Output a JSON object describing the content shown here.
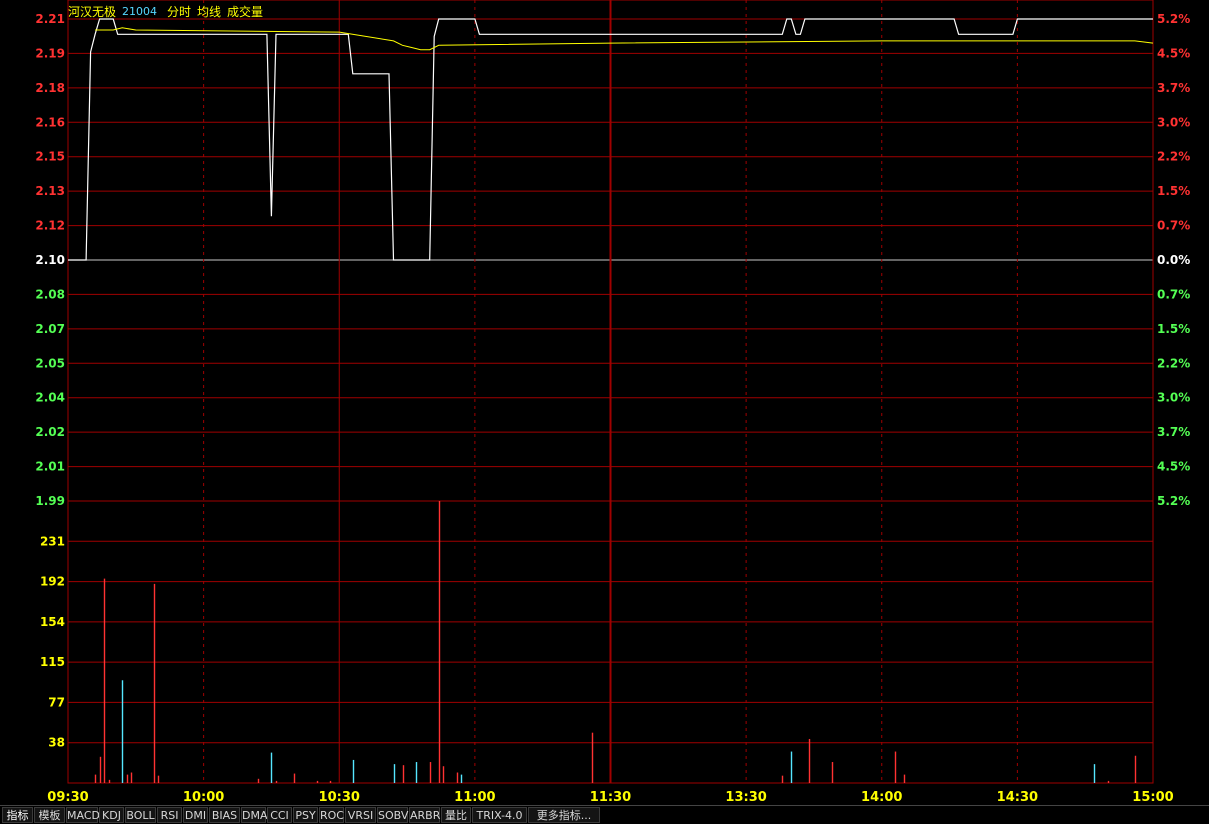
{
  "header": {
    "stock_name": "河汉无极",
    "stock_code": "21004",
    "label_time": "分时",
    "label_avg": "均线",
    "label_volume": "成交量"
  },
  "tabs": [
    "指标",
    "模板",
    "MACD",
    "KDJ",
    "BOLL",
    "RSI",
    "DMI",
    "BIAS",
    "DMA",
    "CCI",
    "PSY",
    "ROC",
    "VRSI",
    "SOBV",
    "ARBR",
    "量比",
    "TRIX-4.0",
    "更多指标..."
  ],
  "colors": {
    "background": "#000000",
    "grid": "#a00000",
    "price_line": "#ffffff",
    "avg_line": "#ffff00",
    "up": "#ff3232",
    "down": "#54ff54",
    "flat": "#ffffff",
    "vol_up": "#ff3232",
    "vol_down": "#55e6ff",
    "time_label": "#ffff00"
  },
  "chart_data": [
    {
      "type": "line",
      "prev_close": 2.1,
      "ylim": [
        1.99,
        2.21
      ],
      "y_ticks_left": [
        "2.21",
        "2.19",
        "2.18",
        "2.16",
        "2.15",
        "2.13",
        "2.12",
        "2.10",
        "2.08",
        "2.07",
        "2.05",
        "2.04",
        "2.02",
        "2.01",
        "1.99"
      ],
      "y_ticks_right": [
        "5.2%",
        "4.5%",
        "3.7%",
        "3.0%",
        "2.2%",
        "1.5%",
        "0.7%",
        "0.0%",
        "0.7%",
        "1.5%",
        "2.2%",
        "3.0%",
        "3.7%",
        "4.5%",
        "5.2%"
      ],
      "x_ticks": [
        "09:30",
        "10:00",
        "10:30",
        "11:00",
        "11:30",
        "13:30",
        "14:00",
        "14:30",
        "15:00"
      ],
      "series": [
        {
          "role": "price",
          "x": [
            "09:30",
            "09:34",
            "09:35",
            "09:36",
            "09:37",
            "09:40",
            "09:41",
            "09:42",
            "10:14",
            "10:15",
            "10:16",
            "10:17",
            "10:32",
            "10:33",
            "10:41",
            "10:42",
            "10:50",
            "10:51",
            "10:52",
            "11:00",
            "11:01",
            "13:38",
            "13:39",
            "13:40",
            "13:41",
            "13:42",
            "13:43",
            "14:16",
            "14:17",
            "14:29",
            "14:30",
            "15:00"
          ],
          "values": [
            2.1,
            2.1,
            2.195,
            2.203,
            2.21,
            2.21,
            2.203,
            2.203,
            2.203,
            2.12,
            2.203,
            2.203,
            2.203,
            2.185,
            2.185,
            2.1,
            2.1,
            2.202,
            2.21,
            2.21,
            2.203,
            2.203,
            2.21,
            2.21,
            2.203,
            2.203,
            2.21,
            2.21,
            2.203,
            2.203,
            2.21,
            2.21
          ]
        },
        {
          "role": "avg",
          "x": [
            "09:36",
            "09:40",
            "09:42",
            "09:45",
            "10:30",
            "10:42",
            "10:44",
            "10:46",
            "10:48",
            "10:50",
            "10:52",
            "11:30",
            "14:00",
            "14:56",
            "15:00"
          ],
          "values": [
            2.205,
            2.205,
            2.206,
            2.205,
            2.204,
            2.2,
            2.198,
            2.197,
            2.196,
            2.196,
            2.198,
            2.199,
            2.2,
            2.2,
            2.199
          ]
        }
      ]
    },
    {
      "type": "bar",
      "ylim": [
        0,
        269
      ],
      "y_ticks": [
        "231",
        "192",
        "154",
        "115",
        "77",
        "38"
      ],
      "bars": [
        {
          "t": "09:36",
          "v": 8,
          "dir": "up"
        },
        {
          "t": "09:37",
          "v": 25,
          "dir": "up"
        },
        {
          "t": "09:38",
          "v": 195,
          "dir": "up"
        },
        {
          "t": "09:39",
          "v": 3,
          "dir": "up"
        },
        {
          "t": "09:42",
          "v": 98,
          "dir": "down"
        },
        {
          "t": "09:43",
          "v": 8,
          "dir": "up"
        },
        {
          "t": "09:44",
          "v": 10,
          "dir": "up"
        },
        {
          "t": "09:49",
          "v": 190,
          "dir": "up"
        },
        {
          "t": "09:50",
          "v": 7,
          "dir": "up"
        },
        {
          "t": "10:12",
          "v": 4,
          "dir": "up"
        },
        {
          "t": "10:15",
          "v": 29,
          "dir": "down"
        },
        {
          "t": "10:16",
          "v": 2,
          "dir": "up"
        },
        {
          "t": "10:20",
          "v": 9,
          "dir": "up"
        },
        {
          "t": "10:25",
          "v": 2,
          "dir": "up"
        },
        {
          "t": "10:28",
          "v": 2,
          "dir": "up"
        },
        {
          "t": "10:33",
          "v": 22,
          "dir": "down"
        },
        {
          "t": "10:42",
          "v": 18,
          "dir": "down"
        },
        {
          "t": "10:44",
          "v": 17,
          "dir": "up"
        },
        {
          "t": "10:47",
          "v": 20,
          "dir": "down"
        },
        {
          "t": "10:50",
          "v": 20,
          "dir": "up"
        },
        {
          "t": "10:52",
          "v": 275,
          "dir": "up"
        },
        {
          "t": "10:53",
          "v": 16,
          "dir": "up"
        },
        {
          "t": "10:56",
          "v": 10,
          "dir": "up"
        },
        {
          "t": "10:57",
          "v": 8,
          "dir": "down"
        },
        {
          "t": "11:26",
          "v": 48,
          "dir": "up"
        },
        {
          "t": "13:38",
          "v": 7,
          "dir": "up"
        },
        {
          "t": "13:40",
          "v": 30,
          "dir": "down"
        },
        {
          "t": "13:44",
          "v": 42,
          "dir": "up"
        },
        {
          "t": "13:49",
          "v": 20,
          "dir": "up"
        },
        {
          "t": "14:03",
          "v": 30,
          "dir": "up"
        },
        {
          "t": "14:05",
          "v": 8,
          "dir": "up"
        },
        {
          "t": "14:47",
          "v": 18,
          "dir": "down"
        },
        {
          "t": "14:50",
          "v": 2,
          "dir": "up"
        },
        {
          "t": "14:56",
          "v": 26,
          "dir": "up"
        }
      ]
    }
  ]
}
